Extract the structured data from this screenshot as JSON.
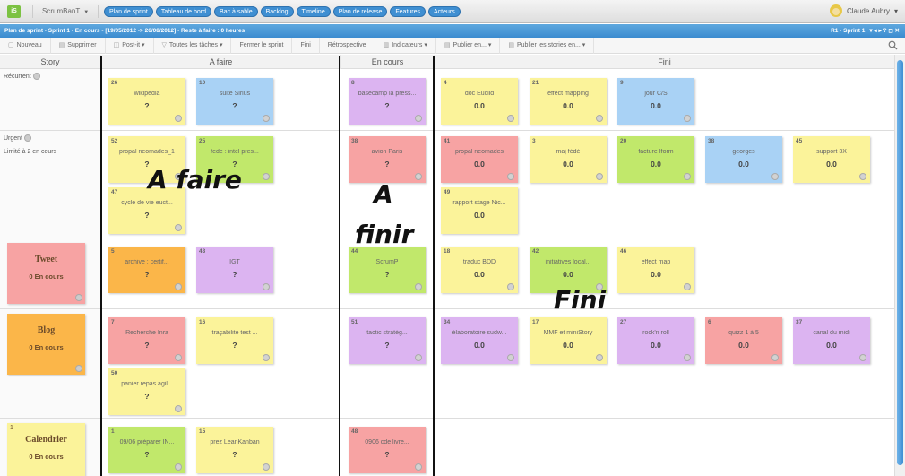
{
  "topbar": {
    "logo": "iS",
    "project": "ScrumBanT",
    "nav": [
      "Plan de sprint",
      "Tableau de bord",
      "Bac à sable",
      "Backlog",
      "Timeline",
      "Plan de release",
      "Features",
      "Acteurs"
    ],
    "user": "Claude Aubry"
  },
  "titlebar": {
    "text": "Plan de sprint - Sprint 1 - En cours - [19/05/2012 -> 26/08/2012] - Reste à faire : 0 heures",
    "sprint": "R1 - Sprint 1",
    "controls": "▾  ◂ ▸   ? ◻ ✕"
  },
  "toolbar": {
    "items": [
      "Nouveau",
      "Supprimer",
      "Post-it",
      "Toutes les tâches",
      "Fermer le sprint",
      "Fini",
      "Rétrospective",
      "Indicateurs",
      "Publier en...",
      "Publier les stories en..."
    ]
  },
  "columns": {
    "story": "Story",
    "todo": "A faire",
    "inprogress": "En cours",
    "done": "Fini"
  },
  "lanes": {
    "recurrent": {
      "label": "Récurrent"
    },
    "urgent": {
      "label": "Urgent",
      "sub": "Limité à 2 en cours"
    },
    "tweet": {
      "name": "Tweet",
      "count": "0  En cours"
    },
    "blog": {
      "name": "Blog",
      "count": "0  En cours"
    },
    "cal": {
      "num": "1",
      "name": "Calendrier",
      "count": "0  En cours"
    }
  },
  "cards": [
    {
      "num": "26",
      "title": "wikipedia",
      "value": "?"
    },
    {
      "num": "10",
      "title": "suite Sirius",
      "value": "?"
    },
    {
      "num": "8",
      "title": "basecamp la press...",
      "value": "?"
    },
    {
      "num": "4",
      "title": "doc Euclid",
      "value": "0.0"
    },
    {
      "num": "21",
      "title": "effect mapping",
      "value": "0.0"
    },
    {
      "num": "9",
      "title": "jour C/S",
      "value": "0.0"
    },
    {
      "num": "52",
      "title": "propal neomades_1",
      "value": "?"
    },
    {
      "num": "25",
      "title": "fede : intel pres...",
      "value": "?"
    },
    {
      "num": "47",
      "title": "cycle de vie euct...",
      "value": "?"
    },
    {
      "num": "38",
      "title": "avion Paris",
      "value": "?"
    },
    {
      "num": "41",
      "title": "propal neomades",
      "value": "0.0"
    },
    {
      "num": "3",
      "title": "maj fédé",
      "value": "0.0"
    },
    {
      "num": "20",
      "title": "facture Iform",
      "value": "0.0"
    },
    {
      "num": "38",
      "title": "georges",
      "value": "0.0"
    },
    {
      "num": "45",
      "title": "support 3X",
      "value": "0.0"
    },
    {
      "num": "49",
      "title": "rapport stage Nic...",
      "value": "0.0"
    },
    {
      "num": "5",
      "title": "archive : certif...",
      "value": "?"
    },
    {
      "num": "43",
      "title": "IGT",
      "value": "?"
    },
    {
      "num": "44",
      "title": "ScrumP",
      "value": "?"
    },
    {
      "num": "18",
      "title": "traduc BDD",
      "value": "0.0"
    },
    {
      "num": "42",
      "title": "initiatives local...",
      "value": "0.0"
    },
    {
      "num": "46",
      "title": "effect map",
      "value": "0.0"
    },
    {
      "num": "7",
      "title": "Recherche Inra",
      "value": "?"
    },
    {
      "num": "16",
      "title": "traçabilité test ...",
      "value": "?"
    },
    {
      "num": "50",
      "title": "panier repas agil...",
      "value": "?"
    },
    {
      "num": "51",
      "title": "tactic stratég...",
      "value": "?"
    },
    {
      "num": "34",
      "title": "élaboratoire sudw...",
      "value": "0.0"
    },
    {
      "num": "17",
      "title": "MMF et miniStory",
      "value": "0.0"
    },
    {
      "num": "27",
      "title": "rock'n roll",
      "value": "0.0"
    },
    {
      "num": "6",
      "title": "quizz 1 à 5",
      "value": "0.0"
    },
    {
      "num": "37",
      "title": "canal du midi",
      "value": "0.0"
    },
    {
      "num": "1",
      "title": "09/06 préparer IN...",
      "value": "?"
    },
    {
      "num": "15",
      "title": "prez LeanKanban",
      "value": "?"
    },
    {
      "num": "48",
      "title": "0906 cde livre...",
      "value": "?"
    }
  ],
  "annotations": {
    "afaire": "A faire",
    "afinir1": "A",
    "afinir2": "finir",
    "fini": "Fini"
  }
}
